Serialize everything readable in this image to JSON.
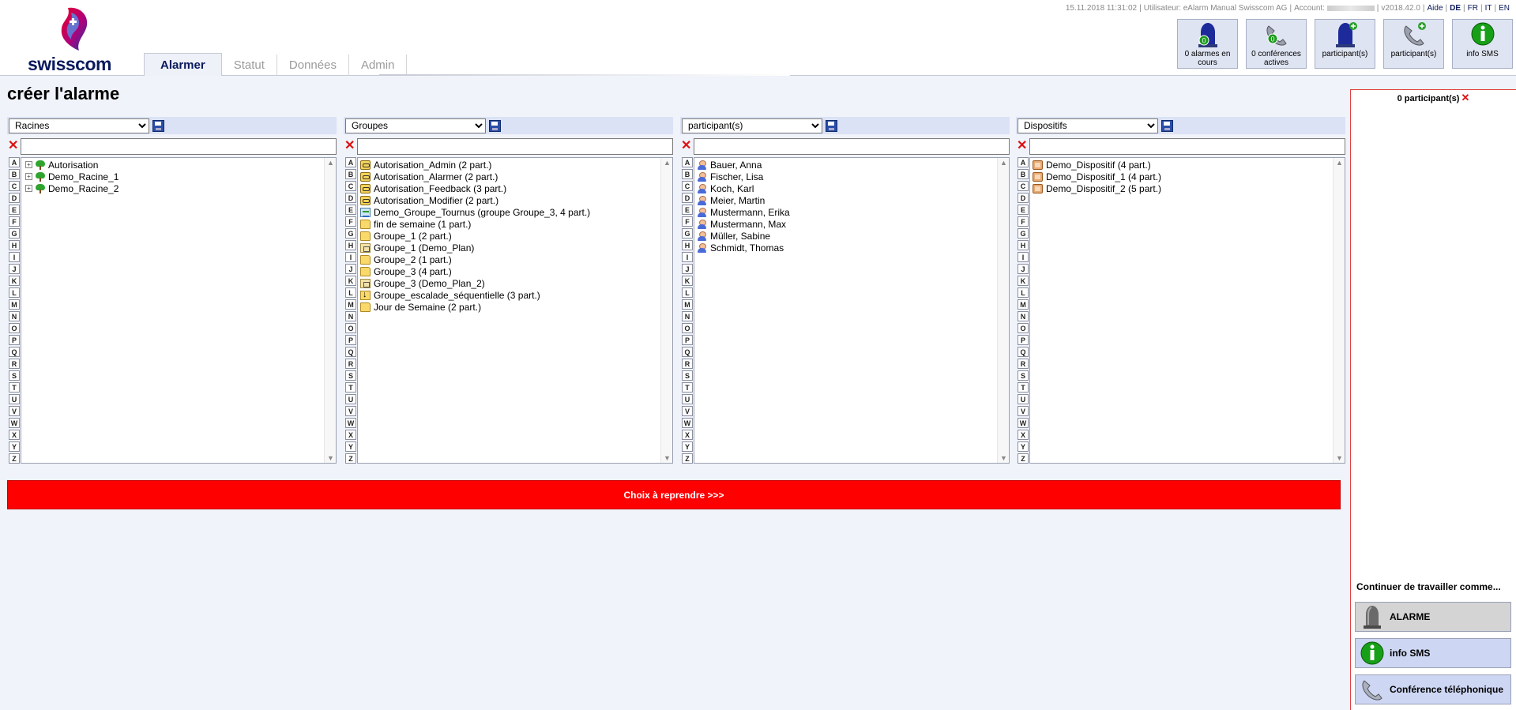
{
  "header": {
    "brand": "swisscom",
    "status_line": {
      "datetime": "15.11.2018 11:31:02",
      "user": "Utilisateur: eAlarm Manual Swisscom AG",
      "account_label": "Account:",
      "version": "v2018.42.0",
      "help": "Aide",
      "languages": [
        "DE",
        "FR",
        "IT",
        "EN"
      ]
    },
    "tabs": [
      {
        "label": "Alarmer",
        "active": true
      },
      {
        "label": "Statut",
        "active": false
      },
      {
        "label": "Données",
        "active": false
      },
      {
        "label": "Admin",
        "active": false
      }
    ],
    "quick_buttons": [
      {
        "icon": "alarm-bell-icon",
        "badge": "0",
        "label": "0 alarmes en cours"
      },
      {
        "icon": "conference-icon",
        "badge": "0",
        "label": "0 conférences actives"
      },
      {
        "icon": "alarm-add-icon",
        "label": "participant(s)"
      },
      {
        "icon": "phone-add-icon",
        "label": "participant(s)"
      },
      {
        "icon": "info-sms-icon",
        "label": "info SMS"
      }
    ]
  },
  "page": {
    "title": "créer l'alarme"
  },
  "columns": [
    {
      "select": "Racines",
      "items": [
        {
          "label": "Autorisation",
          "icon": "tree-icon",
          "expandable": true
        },
        {
          "label": "Demo_Racine_1",
          "icon": "tree-icon",
          "expandable": true
        },
        {
          "label": "Demo_Racine_2",
          "icon": "tree-icon",
          "expandable": true
        }
      ]
    },
    {
      "select": "Groupes",
      "items": [
        {
          "label": "Autorisation_Admin (2 part.)",
          "icon": "key-icon"
        },
        {
          "label": "Autorisation_Alarmer (2 part.)",
          "icon": "key-icon"
        },
        {
          "label": "Autorisation_Feedback (3 part.)",
          "icon": "key-icon"
        },
        {
          "label": "Autorisation_Modifier (2 part.)",
          "icon": "key-icon"
        },
        {
          "label": "Demo_Groupe_Tournus (groupe Groupe_3, 4 part.)",
          "icon": "rotation-icon"
        },
        {
          "label": "fin de semaine (1 part.)",
          "icon": "folder-icon"
        },
        {
          "label": "Groupe_1 (2 part.)",
          "icon": "folder-icon"
        },
        {
          "label": "Groupe_1 (Demo_Plan)",
          "icon": "plan-folder-icon"
        },
        {
          "label": "Groupe_2 (1 part.)",
          "icon": "folder-icon"
        },
        {
          "label": "Groupe_3 (4 part.)",
          "icon": "folder-icon"
        },
        {
          "label": "Groupe_3 (Demo_Plan_2)",
          "icon": "plan-folder-icon"
        },
        {
          "label": "Groupe_escalade_séquentielle (3 part.)",
          "icon": "escalation-icon"
        },
        {
          "label": "Jour de Semaine (2 part.)",
          "icon": "folder-icon"
        }
      ]
    },
    {
      "select": "participant(s)",
      "items": [
        {
          "label": "Bauer, Anna",
          "icon": "person-icon"
        },
        {
          "label": "Fischer, Lisa",
          "icon": "person-icon"
        },
        {
          "label": "Koch, Karl",
          "icon": "person-icon"
        },
        {
          "label": "Meier, Martin",
          "icon": "person-icon"
        },
        {
          "label": "Mustermann, Erika",
          "icon": "person-icon"
        },
        {
          "label": "Mustermann, Max",
          "icon": "person-icon"
        },
        {
          "label": "Müller, Sabine",
          "icon": "person-icon"
        },
        {
          "label": "Schmidt, Thomas",
          "icon": "person-icon"
        }
      ]
    },
    {
      "select": "Dispositifs",
      "items": [
        {
          "label": "Demo_Dispositif (4 part.)",
          "icon": "device-icon"
        },
        {
          "label": "Demo_Dispositif_1 (4 part.)",
          "icon": "device-icon"
        },
        {
          "label": "Demo_Dispositif_2 (5 part.)",
          "icon": "device-icon"
        }
      ]
    }
  ],
  "letters": [
    "A",
    "B",
    "C",
    "D",
    "E",
    "F",
    "G",
    "H",
    "I",
    "J",
    "K",
    "L",
    "M",
    "N",
    "O",
    "P",
    "Q",
    "R",
    "S",
    "T",
    "U",
    "V",
    "W",
    "X",
    "Y",
    "Z"
  ],
  "actions": {
    "choose_label": "Choix à reprendre >>>"
  },
  "right_panel": {
    "count_label": "0 participant(s)",
    "continue_label": "Continuer de travailler comme...",
    "buttons": [
      {
        "label": "ALARME",
        "icon": "alarm-bell-icon"
      },
      {
        "label": "info SMS",
        "icon": "info-sms-icon"
      },
      {
        "label": "Conférence téléphonique",
        "icon": "phone-icon"
      }
    ]
  },
  "colors": {
    "accent_red": "#ff0000",
    "brand_navy": "#0a1a5c",
    "panel_blue": "#dbe2f5"
  }
}
